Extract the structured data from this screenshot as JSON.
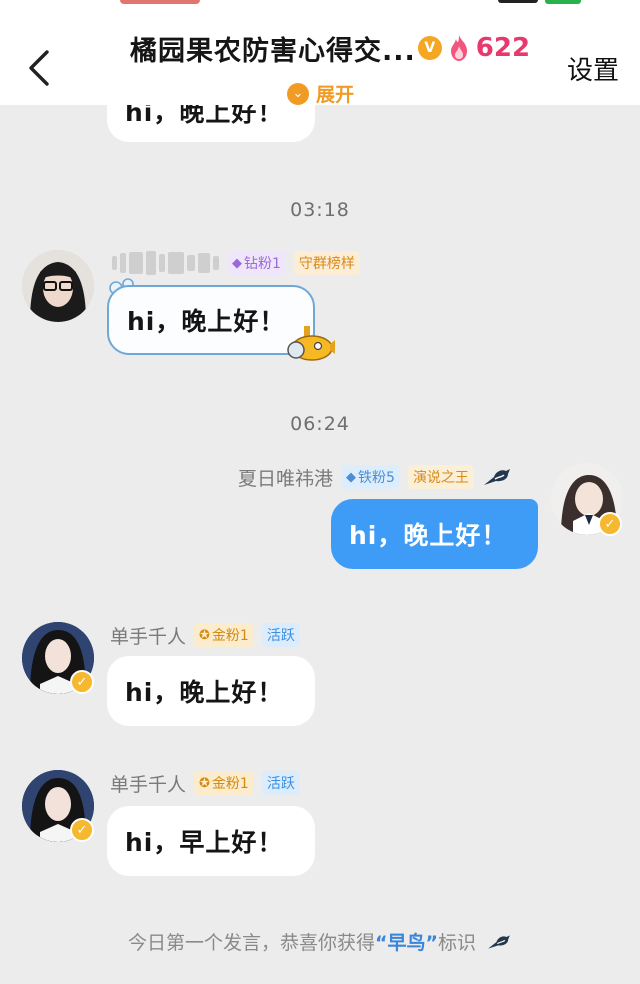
{
  "header": {
    "title": "橘园果农防害心得交...",
    "verified_symbol": "V",
    "heat_count": "622",
    "settings_label": "设置",
    "expand_label": "展开",
    "back_icon": "chevron-left-icon"
  },
  "messages": [
    {
      "kind": "timestamp",
      "text": "03:18"
    },
    {
      "kind": "incoming",
      "tags": [
        "钻粉1",
        "守群榜样"
      ],
      "text": "hi，晚上好！"
    },
    {
      "kind": "timestamp",
      "text": "06:24"
    },
    {
      "kind": "outgoing",
      "sender": "夏日唯祎港",
      "tags": [
        "铁粉5",
        "演说之王"
      ],
      "text": "hi，晚上好！"
    },
    {
      "kind": "incoming",
      "sender": "单手千人",
      "tags": [
        "金粉1",
        "活跃"
      ],
      "text": "hi，晚上好！"
    },
    {
      "kind": "incoming",
      "sender": "单手千人",
      "tags": [
        "金粉1",
        "活跃"
      ],
      "text": "hi，早上好！"
    }
  ],
  "partial_top_message": "hi，晚上好！",
  "footer": {
    "prefix": "今日第一个发言，恭喜你获得",
    "highlight": "“早鸟”",
    "suffix": "标识"
  },
  "colors": {
    "accent_blue": "#3f9cf6",
    "accent_orange": "#f29b24",
    "heat_pink": "#e8396e",
    "background": "#ececec"
  }
}
